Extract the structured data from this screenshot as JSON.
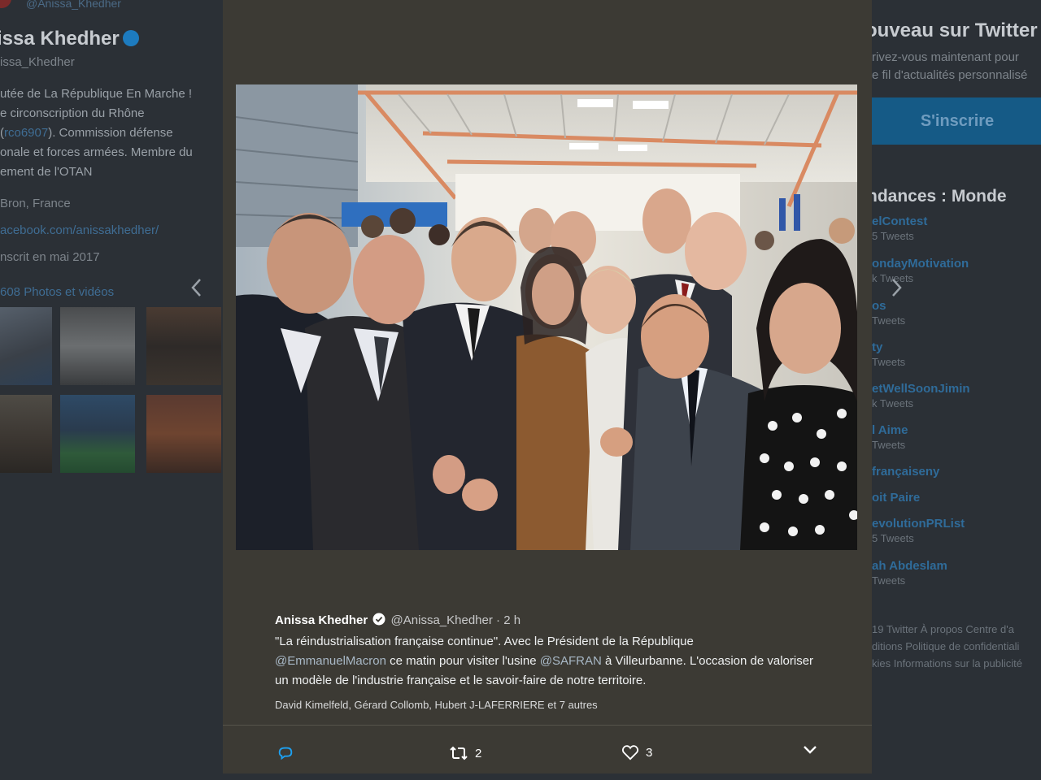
{
  "profile": {
    "handle_top": "@Anissa_Khedher",
    "name": "issa Khedher",
    "handle": "issa_Khedher",
    "bio_line1": "utée de La République En Marche !",
    "bio_line2": "e circonscription du Rhône",
    "bio_line3_link": "rco6907",
    "bio_line3_rest": "). Commission défense",
    "bio_line4": "onale et forces armées. Membre du",
    "bio_line5": "ement de l'OTAN",
    "location": "Bron, France",
    "website": "acebook.com/anissakhedher/",
    "joined": "nscrit en mai 2017",
    "photos_link": "608 Photos et vidéos"
  },
  "signup": {
    "title": "ouveau sur Twitter",
    "line1": "rivez-vous maintenant pour",
    "line2": "e fil d'actualités personnalisé",
    "button": "S'inscrire"
  },
  "trends": {
    "title": "ndances : Monde",
    "items": [
      {
        "name": "elContest",
        "count": "5 Tweets"
      },
      {
        "name": "ondayMotivation",
        "count": "k Tweets"
      },
      {
        "name": "os",
        "count": "Tweets"
      },
      {
        "name": "ty",
        "count": "Tweets"
      },
      {
        "name": "etWellSoonJimin",
        "count": "k Tweets"
      },
      {
        "name": "l Aime",
        "count": "Tweets"
      },
      {
        "name": "françaiseny",
        "count": ""
      },
      {
        "name": "oit Paire",
        "count": ""
      },
      {
        "name": "evolutionPRList",
        "count": "5 Tweets"
      },
      {
        "name": "ah Abdeslam",
        "count": "Tweets"
      }
    ]
  },
  "footer": {
    "line1": "19 Twitter   À propos   Centre d'a",
    "line2": "ditions   Politique de confidentiali",
    "line3": "kies   Informations sur la publicité"
  },
  "tweet": {
    "author": "Anissa Khedher",
    "handle": "@Anissa_Khedher",
    "time": "· 2 h",
    "text_part1": "\"La réindustrialisation française continue\". Avec le Président de la République",
    "mention1": "@EmmanuelMacron",
    "text_part2": " ce matin pour visiter l'usine ",
    "mention2": "@SAFRAN",
    "text_part3": " à Villeurbanne. L'occasion de valoriser un modèle de l'industrie française et le savoir-faire de notre territoire.",
    "tagged_people": "David Kimelfeld, Gérard Collomb, Hubert J-LAFERRIERE",
    "tagged_and": "et",
    "tagged_others": "7 autres"
  },
  "actions": {
    "retweets": "2",
    "likes": "3"
  },
  "colors": {
    "accent": "#1da1f2",
    "modal_bg": "#3c3a34",
    "page_dim": "#2b3036"
  },
  "icons": [
    "reply-icon",
    "retweet-icon",
    "heart-icon",
    "chevron-down-icon",
    "verified-badge-icon",
    "chevron-left-icon",
    "chevron-right-icon"
  ]
}
